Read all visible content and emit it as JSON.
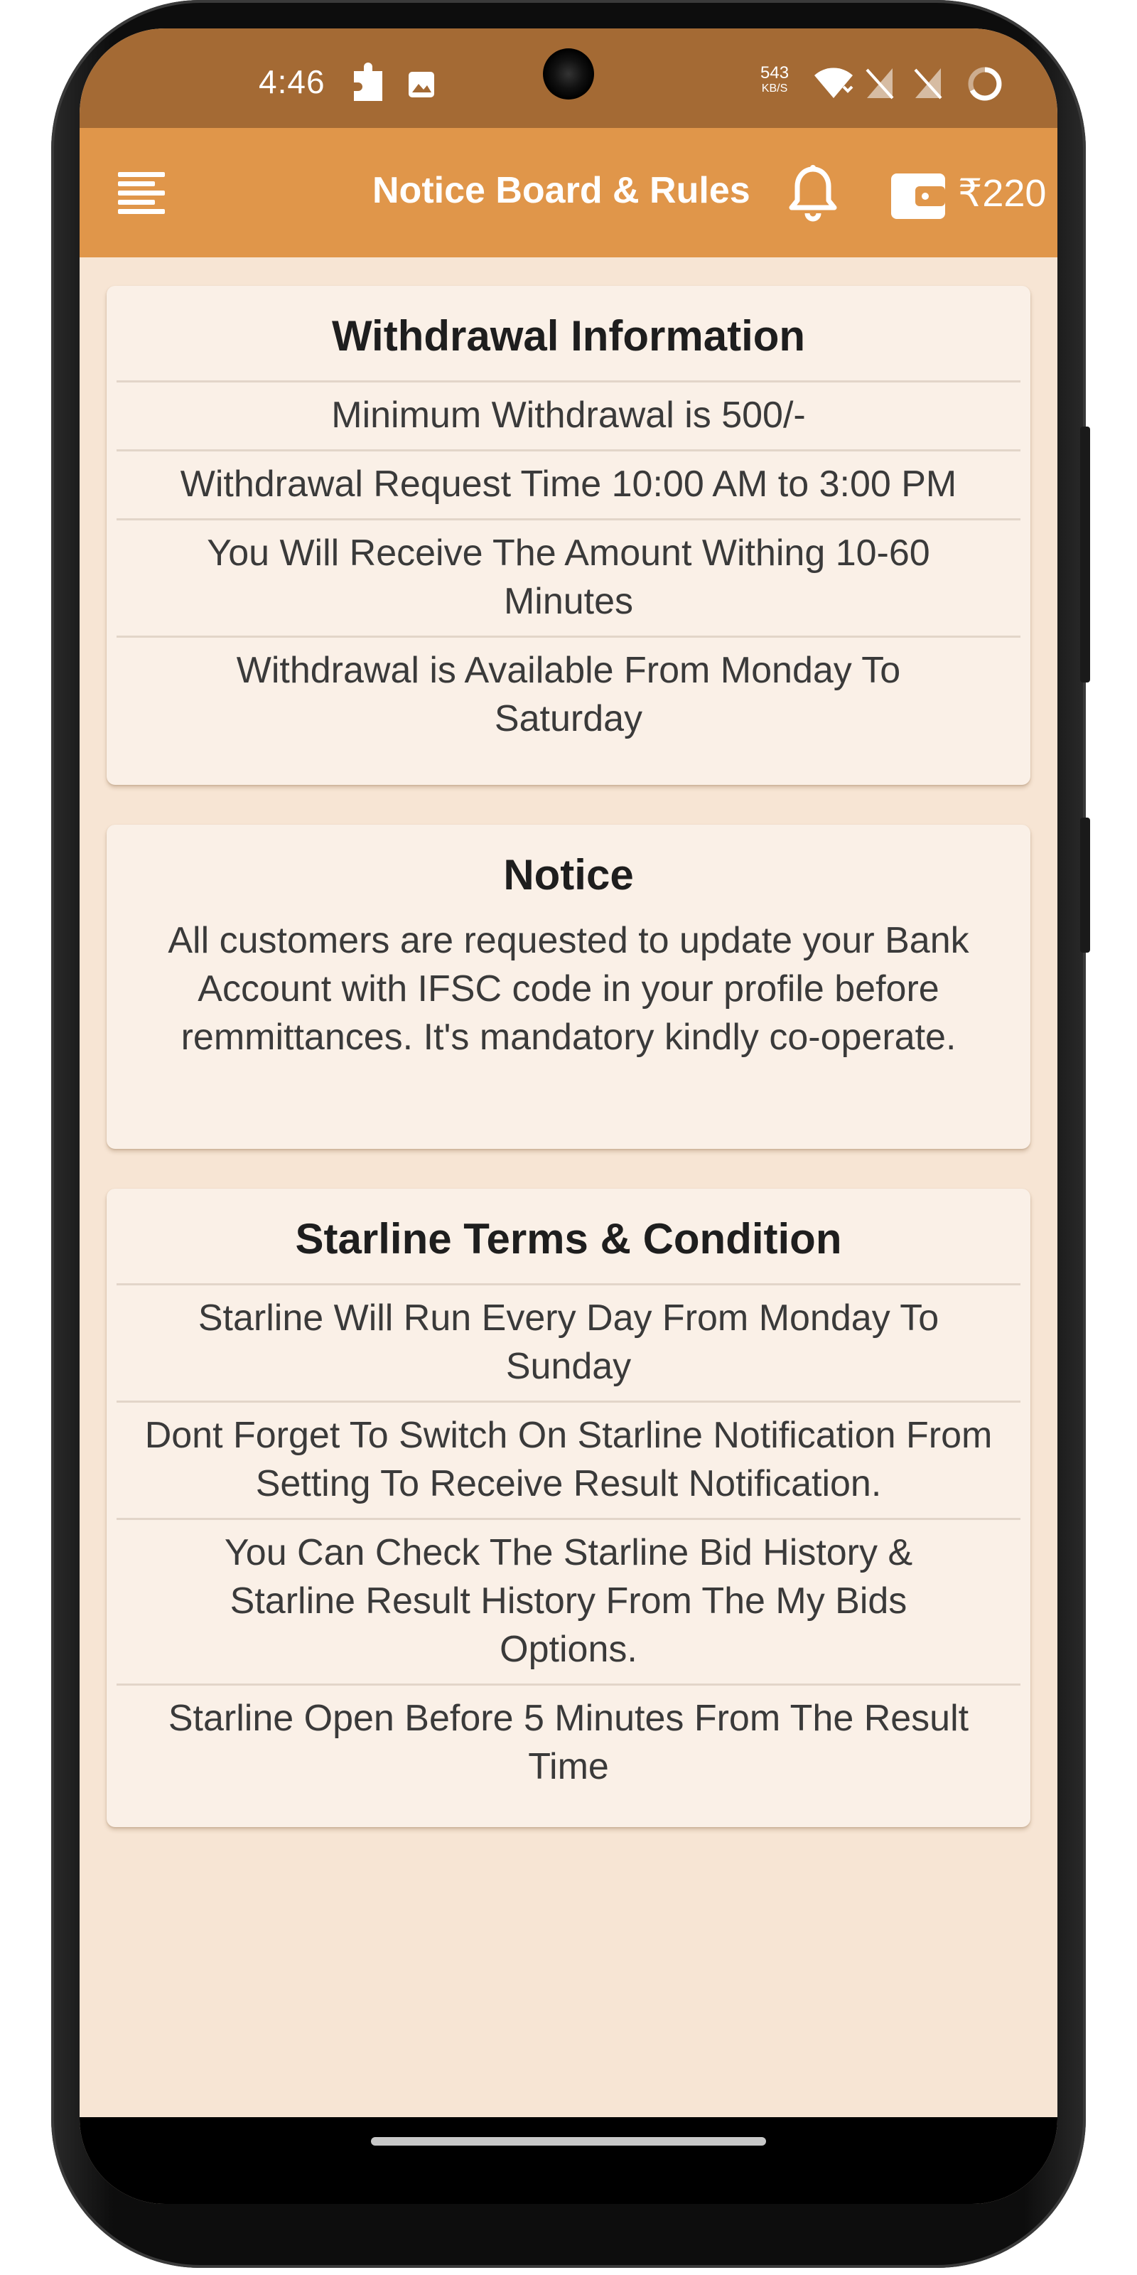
{
  "status_bar": {
    "time": "4:46",
    "net_speed_value": "543",
    "net_speed_unit": "KB/S",
    "icons": [
      "puzzle-icon",
      "image-icon",
      "wifi-icon",
      "no-sim-icon",
      "no-sim-icon",
      "battery-ring-icon"
    ]
  },
  "app_bar": {
    "title": "Notice Board & Rules",
    "wallet_amount": "₹220",
    "icons": [
      "menu-icon",
      "bell-icon",
      "wallet-icon"
    ]
  },
  "withdrawal": {
    "title": "Withdrawal Information",
    "rules": [
      "Minimum Withdrawal is 500/-",
      "Withdrawal Request Time 10:00 AM to 3:00 PM",
      "You Will Receive The Amount Withing 10-60 Minutes",
      "Withdrawal is Available From Monday To Saturday"
    ]
  },
  "notice": {
    "title": "Notice",
    "body": "All customers are requested to update your Bank Account with IFSC code in your profile before remmittances. It's mandatory kindly co-operate."
  },
  "starline": {
    "title": "Starline Terms & Condition",
    "rules": [
      "Starline Will Run Every Day From Monday To Sunday",
      "Dont Forget To Switch On Starline Notification From Setting To Receive Result Notification.",
      "You Can Check The Starline Bid History & Starline Result History From The My Bids Options.",
      "Starline Open Before 5 Minutes From The Result Time"
    ]
  },
  "colors": {
    "status_bar": "#a46a34",
    "app_bar": "#e0964a",
    "background": "#f7e5d4",
    "card": "#faf0e7"
  }
}
